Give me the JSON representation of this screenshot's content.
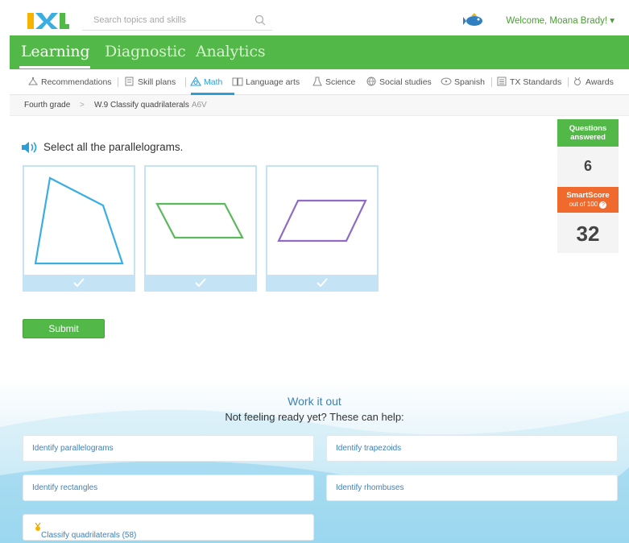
{
  "header": {
    "logo_text": "IXL",
    "search_placeholder": "Search topics and skills",
    "welcome": "Welcome, Moana Brady! ▾"
  },
  "main_nav": {
    "tabs": [
      {
        "label": "Learning",
        "active": true
      },
      {
        "label": "Diagnostic",
        "active": false
      },
      {
        "label": "Analytics",
        "active": false
      }
    ]
  },
  "subject_nav": {
    "items": [
      {
        "label": "Recommendations",
        "icon": "recommendations-icon"
      },
      {
        "label": "Skill plans",
        "icon": "skill-plans-icon"
      },
      {
        "label": "Math",
        "icon": "math-icon",
        "active": true
      },
      {
        "label": "Language arts",
        "icon": "language-arts-icon"
      },
      {
        "label": "Science",
        "icon": "science-icon"
      },
      {
        "label": "Social studies",
        "icon": "social-studies-icon"
      },
      {
        "label": "Spanish",
        "icon": "spanish-icon"
      },
      {
        "label": "TX Standards",
        "icon": "standards-icon"
      },
      {
        "label": "Awards",
        "icon": "awards-icon"
      }
    ]
  },
  "breadcrumb": {
    "grade": "Fourth grade",
    "separator": ">",
    "skill": "W.9 Classify quadrilaterals",
    "code": "A6V"
  },
  "question": {
    "prompt": "Select all the parallelograms.",
    "choices": [
      {
        "shape": "irregular-quadrilateral",
        "color": "#3aaee0"
      },
      {
        "shape": "parallelogram",
        "color": "#5cb85c"
      },
      {
        "shape": "parallelogram",
        "color": "#8e6cc6"
      }
    ],
    "submit_label": "Submit"
  },
  "side_panel": {
    "questions_answered_label_1": "Questions",
    "questions_answered_label_2": "answered",
    "questions_answered_value": "6",
    "smartscore_label": "SmartScore",
    "smartscore_sub": "out of 100",
    "smartscore_help": "?",
    "smartscore_value": "32"
  },
  "work_it_out": {
    "title": "Work it out",
    "subtitle": "Not feeling ready yet? These can help:",
    "links": [
      {
        "label": "Identify parallelograms"
      },
      {
        "label": "Identify trapezoids"
      },
      {
        "label": "Identify rectangles"
      },
      {
        "label": "Identify rhombuses"
      },
      {
        "label": "Classify quadrilaterals (58)"
      }
    ]
  },
  "colors": {
    "brand_green": "#52b847",
    "accent_blue": "#2e9fd6",
    "smartscore_orange": "#ef6a2c",
    "link_blue": "#3d80b8"
  }
}
